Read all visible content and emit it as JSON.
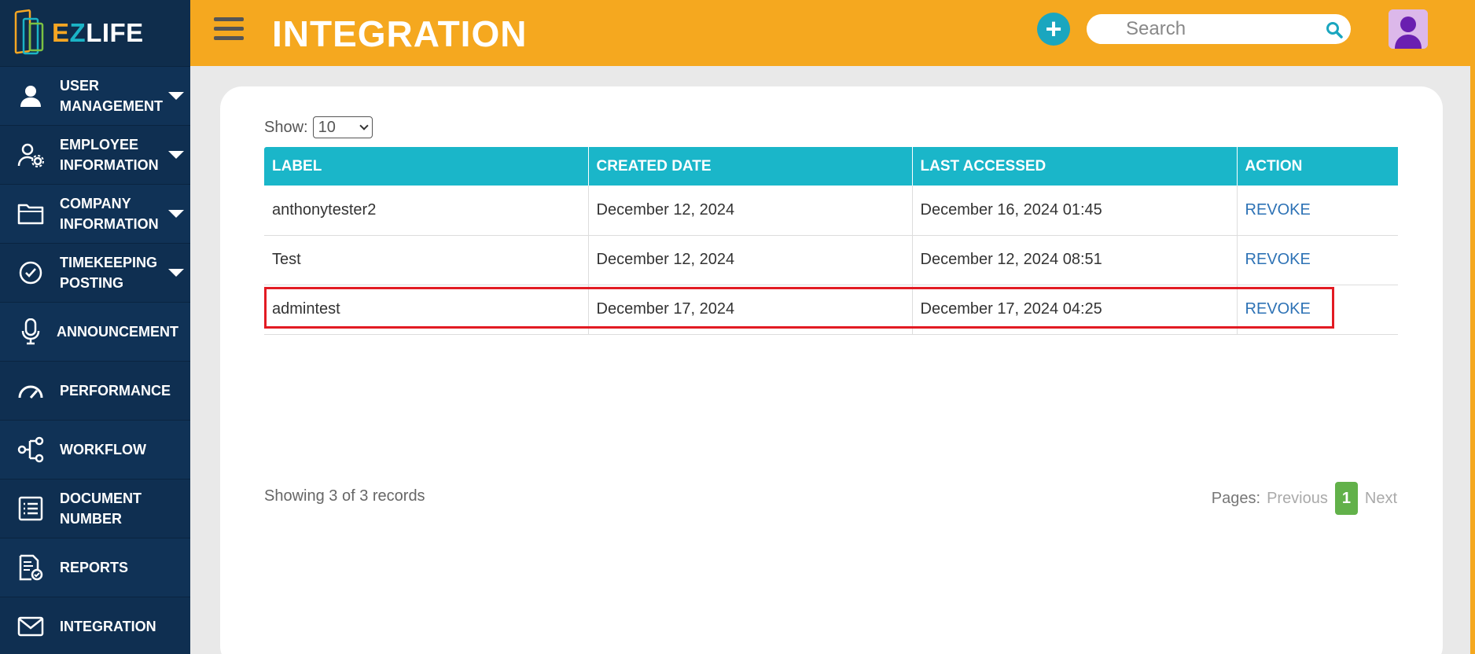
{
  "sidebar": {
    "logo": {
      "part1": "E",
      "part2": "Z",
      "part3": "LIFE"
    },
    "items": [
      {
        "label_line1": "USER",
        "label_line2": "MANAGEMENT",
        "icon": "user-icon",
        "has_caret": true
      },
      {
        "label_line1": "EMPLOYEE",
        "label_line2": "INFORMATION",
        "icon": "user-gear-icon",
        "has_caret": true
      },
      {
        "label_line1": "COMPANY",
        "label_line2": "INFORMATION",
        "icon": "folder-icon",
        "has_caret": true
      },
      {
        "label_line1": "TIMEKEEPING",
        "label_line2": "POSTING",
        "icon": "check-circle-icon",
        "has_caret": true
      },
      {
        "label_line1": "ANNOUNCEMENT",
        "label_line2": "",
        "icon": "microphone-icon",
        "has_caret": false
      },
      {
        "label_line1": "PERFORMANCE",
        "label_line2": "",
        "icon": "gauge-icon",
        "has_caret": false
      },
      {
        "label_line1": "WORKFLOW",
        "label_line2": "",
        "icon": "workflow-icon",
        "has_caret": false
      },
      {
        "label_line1": "DOCUMENT",
        "label_line2": "NUMBER",
        "icon": "list-icon",
        "has_caret": false
      },
      {
        "label_line1": "REPORTS",
        "label_line2": "",
        "icon": "report-icon",
        "has_caret": false
      },
      {
        "label_line1": "INTEGRATION",
        "label_line2": "",
        "icon": "envelope-icon",
        "has_caret": false
      }
    ]
  },
  "header": {
    "title": "INTEGRATION",
    "add_label": "+",
    "search_placeholder": "Search"
  },
  "main": {
    "show_label": "Show:",
    "show_value": "10",
    "columns": [
      "LABEL",
      "CREATED DATE",
      "LAST ACCESSED",
      "ACTION"
    ],
    "rows": [
      {
        "label": "anthonytester2",
        "created": "December 12, 2024",
        "accessed": "December 16, 2024 01:45",
        "action": "REVOKE"
      },
      {
        "label": "Test",
        "created": "December 12, 2024",
        "accessed": "December 12, 2024 08:51",
        "action": "REVOKE"
      },
      {
        "label": "admintest",
        "created": "December 17, 2024",
        "accessed": "December 17, 2024 04:25",
        "action": "REVOKE"
      }
    ],
    "records_text": "Showing 3 of 3 records",
    "pager": {
      "label": "Pages:",
      "previous": "Previous",
      "current": "1",
      "next": "Next"
    }
  },
  "colors": {
    "header_bg": "#f5a81f",
    "sidebar_bg": "#0f2d4c",
    "table_header_bg": "#1ab6c9",
    "accent_teal": "#1aa6bf",
    "highlight_border": "#e21b23",
    "page_active": "#62b14a"
  }
}
